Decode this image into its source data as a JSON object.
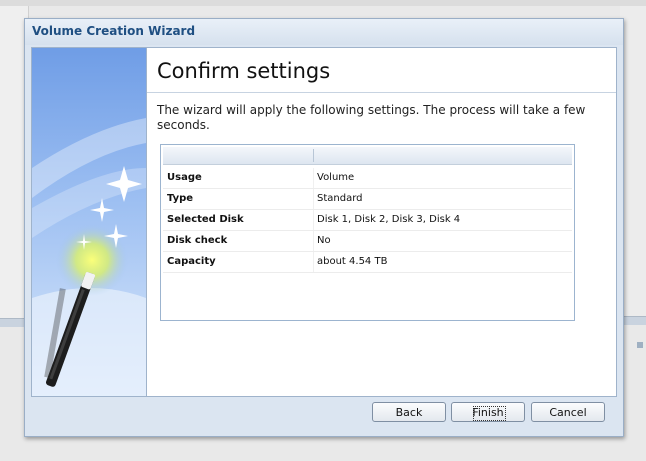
{
  "window": {
    "title": "Volume Creation Wizard"
  },
  "page": {
    "heading": "Confirm settings",
    "description": "The wizard will apply the following settings. The process will take a few seconds."
  },
  "settings_table": {
    "rows": [
      {
        "key": "Usage",
        "value": "Volume"
      },
      {
        "key": "Type",
        "value": "Standard"
      },
      {
        "key": "Selected Disk",
        "value": "Disk 1, Disk 2, Disk 3, Disk 4"
      },
      {
        "key": "Disk check",
        "value": "No"
      },
      {
        "key": "Capacity",
        "value": "about 4.54 TB"
      }
    ]
  },
  "buttons": {
    "back": "Back",
    "finish": "Finish",
    "cancel": "Cancel"
  },
  "icons": {
    "side_art": "magic-wand-icon"
  },
  "colors": {
    "title_text": "#1f4f82",
    "window_frame": "#dbe5f1",
    "table_border": "#9cb4cf"
  }
}
